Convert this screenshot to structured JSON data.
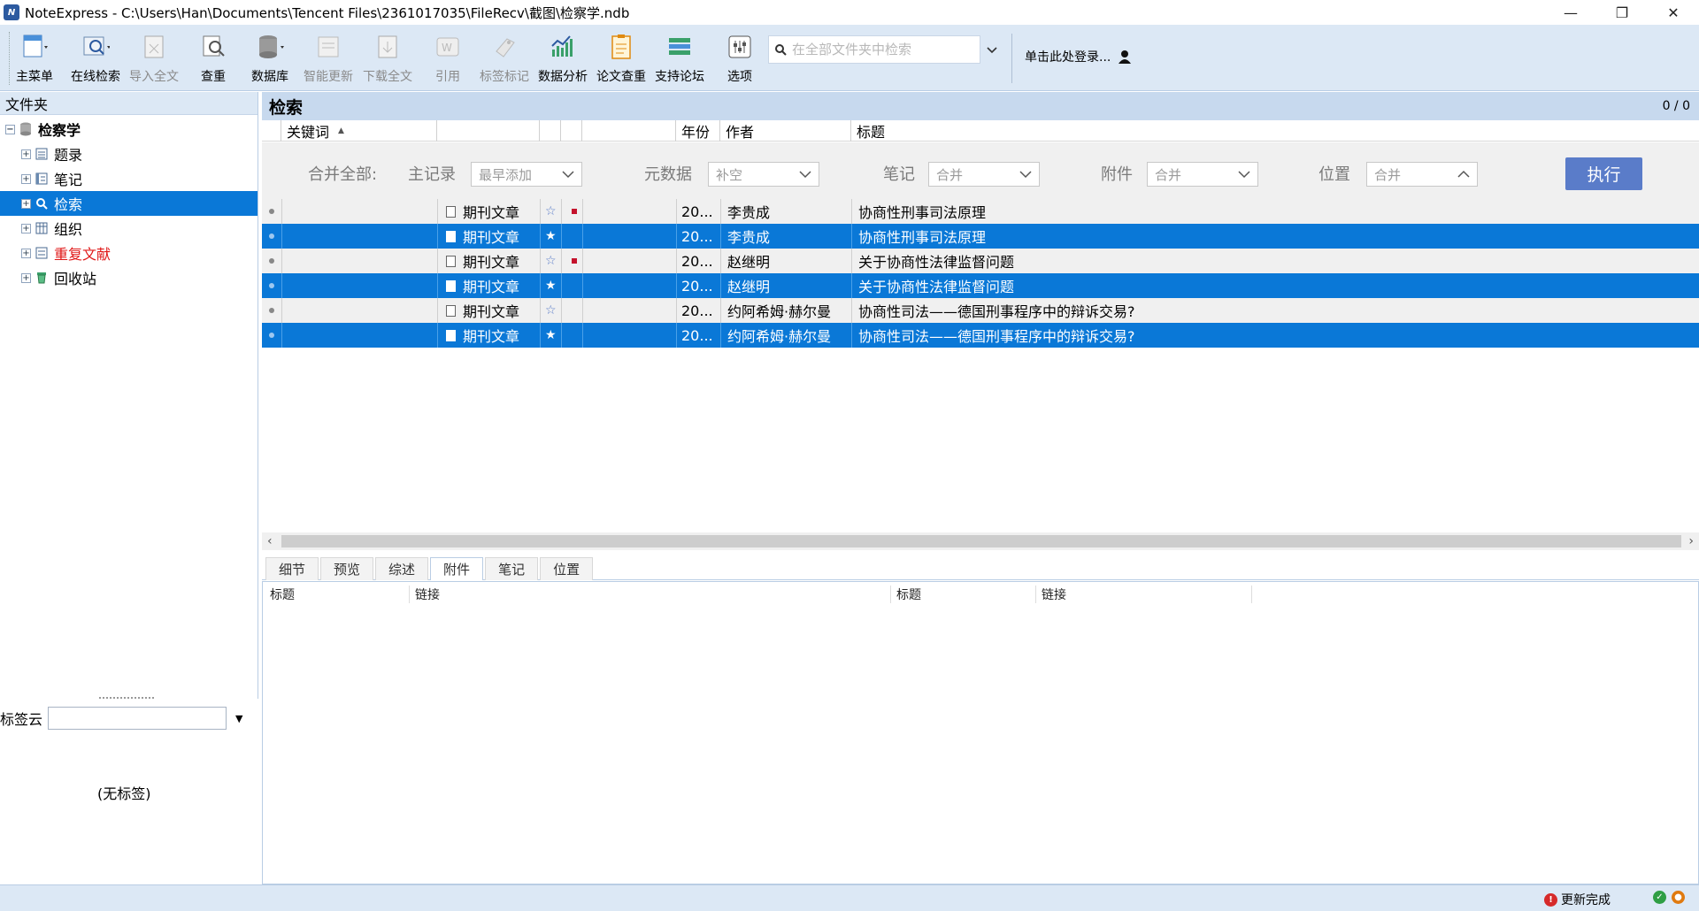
{
  "window": {
    "title": "NoteExpress - C:\\Users\\Han\\Documents\\Tencent Files\\2361017035\\FileRecv\\截图\\检察学.ndb",
    "minimize": "—",
    "restore": "❐",
    "close": "✕"
  },
  "toolbar": {
    "buttons": [
      {
        "label": "主菜单",
        "icon": "main-menu-icon",
        "enabled": true
      },
      {
        "label": "在线检索",
        "icon": "online-search-icon",
        "enabled": true
      },
      {
        "label": "导入全文",
        "icon": "import-fulltext-icon",
        "enabled": false
      },
      {
        "label": "查重",
        "icon": "duplicate-check-icon",
        "enabled": true
      },
      {
        "label": "数据库",
        "icon": "database-icon",
        "enabled": true
      },
      {
        "label": "智能更新",
        "icon": "smart-update-icon",
        "enabled": false
      },
      {
        "label": "下载全文",
        "icon": "download-fulltext-icon",
        "enabled": false
      },
      {
        "label": "引用",
        "icon": "cite-icon",
        "enabled": false
      },
      {
        "label": "标签标记",
        "icon": "tag-icon",
        "enabled": false
      },
      {
        "label": "数据分析",
        "icon": "data-analysis-icon",
        "enabled": true
      },
      {
        "label": "论文查重",
        "icon": "paper-check-icon",
        "enabled": true
      },
      {
        "label": "支持论坛",
        "icon": "forum-icon",
        "enabled": true
      },
      {
        "label": "选项",
        "icon": "options-icon",
        "enabled": true
      }
    ],
    "search_placeholder": "在全部文件夹中检索",
    "login_label": "单击此处登录..."
  },
  "folders": {
    "header": "文件夹",
    "items": [
      {
        "label": "检察学",
        "icon": "database-icon"
      },
      {
        "label": "题录",
        "icon": "list-icon"
      },
      {
        "label": "笔记",
        "icon": "notes-icon"
      },
      {
        "label": "检索",
        "icon": "search-icon"
      },
      {
        "label": "组织",
        "icon": "organize-icon"
      },
      {
        "label": "重复文献",
        "icon": "duplicate-icon"
      },
      {
        "label": "回收站",
        "icon": "recycle-bin-icon"
      }
    ],
    "tagcloud_label": "标签云",
    "no_tags": "(无标签)"
  },
  "main": {
    "title": "检索",
    "count": "0 / 0",
    "columns": {
      "keyword": "关键词",
      "sort_arrow": "▲",
      "year": "年份",
      "author": "作者",
      "title": "标题"
    },
    "merge": {
      "all_label": "合并全部:",
      "main_label": "主记录",
      "main_value": "最早添加",
      "meta_label": "元数据",
      "meta_value": "补空",
      "notes_label": "笔记",
      "notes_value": "合并",
      "attach_label": "附件",
      "attach_value": "合并",
      "location_label": "位置",
      "location_value": "合并",
      "execute": "执行"
    },
    "rows": [
      {
        "type": "期刊文章",
        "year": "20...",
        "author": "李贵成",
        "title": "协商性刑事司法原理",
        "flag": true,
        "selected": false,
        "star": "☆"
      },
      {
        "type": "期刊文章",
        "year": "20...",
        "author": "李贵成",
        "title": "协商性刑事司法原理",
        "flag": false,
        "selected": true,
        "star": "★"
      },
      {
        "type": "期刊文章",
        "year": "20...",
        "author": "赵继明",
        "title": "关于协商性法律监督问题",
        "flag": true,
        "selected": false,
        "star": "☆"
      },
      {
        "type": "期刊文章",
        "year": "20...",
        "author": "赵继明",
        "title": "关于协商性法律监督问题",
        "flag": false,
        "selected": true,
        "star": "★"
      },
      {
        "type": "期刊文章",
        "year": "20...",
        "author": "约阿希姆·赫尔曼",
        "title": "协商性司法——德国刑事程序中的辩诉交易?",
        "flag": false,
        "selected": false,
        "star": "☆"
      },
      {
        "type": "期刊文章",
        "year": "20...",
        "author": "约阿希姆·赫尔曼",
        "title": "协商性司法——德国刑事程序中的辩诉交易?",
        "flag": false,
        "selected": true,
        "star": "★"
      }
    ],
    "tabs": [
      "细节",
      "预览",
      "综述",
      "附件",
      "笔记",
      "位置"
    ],
    "detail_columns": [
      "标题",
      "链接",
      "标题",
      "链接"
    ]
  },
  "status": {
    "update_text": "更新完成"
  },
  "colors": {
    "selection": "#0a78d7",
    "execute_button": "#5a7cc9",
    "toolbar_bg": "#dce8f5"
  }
}
